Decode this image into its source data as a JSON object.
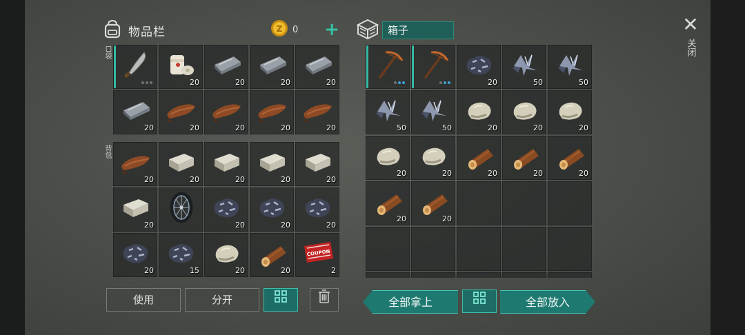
{
  "inventory": {
    "title": "物品栏",
    "coins": "0",
    "plus_label": "+",
    "pocket_label": "口袋",
    "backpack_label": "背包",
    "pocket": [
      {
        "name": "machete",
        "icon": "machete-icon",
        "qty": "",
        "dots": [
          "gray",
          "gray",
          "gray"
        ],
        "selected": true
      },
      {
        "name": "bandage",
        "icon": "bandage-icon",
        "qty": "20"
      },
      {
        "name": "iron-ingot",
        "icon": "iron-ingot-icon",
        "qty": "20"
      },
      {
        "name": "iron-ingot",
        "icon": "iron-ingot-icon",
        "qty": "20"
      },
      {
        "name": "iron-ingot",
        "icon": "iron-ingot-icon",
        "qty": "20"
      },
      {
        "name": "iron-ingot",
        "icon": "iron-ingot-icon",
        "qty": "20"
      },
      {
        "name": "leather",
        "icon": "leather-icon",
        "qty": "20"
      },
      {
        "name": "leather",
        "icon": "leather-icon",
        "qty": "20"
      },
      {
        "name": "leather",
        "icon": "leather-icon",
        "qty": "20"
      },
      {
        "name": "leather",
        "icon": "leather-icon",
        "qty": "20"
      }
    ],
    "backpack": [
      {
        "name": "leather",
        "icon": "leather-icon",
        "qty": "20"
      },
      {
        "name": "stone-block",
        "icon": "stone-block-icon",
        "qty": "20"
      },
      {
        "name": "stone-block",
        "icon": "stone-block-icon",
        "qty": "20"
      },
      {
        "name": "stone-block",
        "icon": "stone-block-icon",
        "qty": "20"
      },
      {
        "name": "stone-block",
        "icon": "stone-block-icon",
        "qty": "20"
      },
      {
        "name": "stone-block",
        "icon": "stone-block-icon",
        "qty": "20"
      },
      {
        "name": "wheel",
        "icon": "wheel-icon",
        "qty": ""
      },
      {
        "name": "iron-ore",
        "icon": "iron-ore-icon",
        "qty": "20"
      },
      {
        "name": "iron-ore",
        "icon": "iron-ore-icon",
        "qty": "20"
      },
      {
        "name": "iron-ore",
        "icon": "iron-ore-icon",
        "qty": "20"
      },
      {
        "name": "iron-ore",
        "icon": "iron-ore-icon",
        "qty": "20"
      },
      {
        "name": "iron-ore",
        "icon": "iron-ore-icon",
        "qty": "15"
      },
      {
        "name": "stone",
        "icon": "stone-icon",
        "qty": "20"
      },
      {
        "name": "log",
        "icon": "log-icon",
        "qty": "20"
      },
      {
        "name": "coupon",
        "icon": "coupon-icon",
        "qty": "2"
      }
    ],
    "buttons": {
      "use": "使用",
      "split": "分开"
    }
  },
  "box": {
    "title": "箱子",
    "items": [
      {
        "name": "pickaxe",
        "icon": "pickaxe-icon",
        "qty": "",
        "dots": [
          "gray",
          "blue",
          "blue"
        ],
        "selected": true
      },
      {
        "name": "pickaxe",
        "icon": "pickaxe-icon",
        "qty": "",
        "dots": [
          "gray",
          "blue",
          "blue"
        ],
        "selected": true
      },
      {
        "name": "iron-ore",
        "icon": "iron-ore-icon",
        "qty": "20"
      },
      {
        "name": "metal-scrap",
        "icon": "metal-scrap-icon",
        "qty": "50"
      },
      {
        "name": "metal-scrap",
        "icon": "metal-scrap-icon",
        "qty": "50"
      },
      {
        "name": "metal-scrap",
        "icon": "metal-scrap-icon",
        "qty": "50"
      },
      {
        "name": "metal-scrap",
        "icon": "metal-scrap-icon",
        "qty": "50"
      },
      {
        "name": "stone",
        "icon": "stone-icon",
        "qty": "20"
      },
      {
        "name": "stone",
        "icon": "stone-icon",
        "qty": "20"
      },
      {
        "name": "stone",
        "icon": "stone-icon",
        "qty": "20"
      },
      {
        "name": "stone",
        "icon": "stone-icon",
        "qty": "20"
      },
      {
        "name": "stone",
        "icon": "stone-icon",
        "qty": "20"
      },
      {
        "name": "log",
        "icon": "log-icon",
        "qty": "20"
      },
      {
        "name": "log",
        "icon": "log-icon",
        "qty": "20"
      },
      {
        "name": "log",
        "icon": "log-icon",
        "qty": "20"
      },
      {
        "name": "log",
        "icon": "log-icon",
        "qty": "20"
      },
      {
        "name": "log",
        "icon": "log-icon",
        "qty": "20"
      },
      {
        "name": "",
        "icon": "",
        "qty": ""
      },
      {
        "name": "",
        "icon": "",
        "qty": ""
      },
      {
        "name": "",
        "icon": "",
        "qty": ""
      },
      {
        "name": "",
        "icon": "",
        "qty": ""
      },
      {
        "name": "",
        "icon": "",
        "qty": ""
      },
      {
        "name": "",
        "icon": "",
        "qty": ""
      },
      {
        "name": "",
        "icon": "",
        "qty": ""
      },
      {
        "name": "",
        "icon": "",
        "qty": ""
      },
      {
        "name": "",
        "icon": "",
        "qty": ""
      },
      {
        "name": "",
        "icon": "",
        "qty": ""
      },
      {
        "name": "",
        "icon": "",
        "qty": ""
      },
      {
        "name": "",
        "icon": "",
        "qty": ""
      },
      {
        "name": "",
        "icon": "",
        "qty": ""
      }
    ],
    "buttons": {
      "take_all": "全部拿上",
      "put_all": "全部放入"
    }
  },
  "close_label": "关闭",
  "colors": {
    "accent": "#35c2a6",
    "button_teal": "#1e7a70"
  }
}
